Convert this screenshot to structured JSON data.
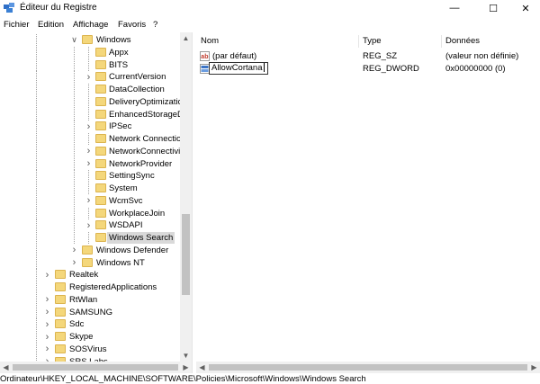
{
  "window": {
    "title": "Éditeur du Registre",
    "minimize": "—",
    "maximize": "☐",
    "close": "✕"
  },
  "menu": [
    "Fichier",
    "Edition",
    "Affichage",
    "Favoris",
    "?"
  ],
  "tree": {
    "items": [
      {
        "label": "Windows",
        "expander": "chevron-down",
        "level": 0
      },
      {
        "label": "Appx",
        "expander": "none",
        "level": 1
      },
      {
        "label": "BITS",
        "expander": "none",
        "level": 1
      },
      {
        "label": "CurrentVersion",
        "expander": "chevron-right",
        "level": 1
      },
      {
        "label": "DataCollection",
        "expander": "none",
        "level": 1
      },
      {
        "label": "DeliveryOptimizatic",
        "expander": "none",
        "level": 1
      },
      {
        "label": "EnhancedStorageDe",
        "expander": "none",
        "level": 1
      },
      {
        "label": "IPSec",
        "expander": "chevron-right",
        "level": 1
      },
      {
        "label": "Network Connectio",
        "expander": "none",
        "level": 1
      },
      {
        "label": "NetworkConnectivi",
        "expander": "chevron-right",
        "level": 1
      },
      {
        "label": "NetworkProvider",
        "expander": "chevron-right",
        "level": 1
      },
      {
        "label": "SettingSync",
        "expander": "none",
        "level": 1
      },
      {
        "label": "System",
        "expander": "none",
        "level": 1
      },
      {
        "label": "WcmSvc",
        "expander": "chevron-right",
        "level": 1
      },
      {
        "label": "WorkplaceJoin",
        "expander": "none",
        "level": 1
      },
      {
        "label": "WSDAPI",
        "expander": "chevron-right",
        "level": 1
      },
      {
        "label": "Windows Search",
        "expander": "none",
        "level": 1,
        "selected": true
      },
      {
        "label": "Windows Defender",
        "expander": "chevron-right",
        "level": 0
      },
      {
        "label": "Windows NT",
        "expander": "chevron-right",
        "level": 0
      },
      {
        "label": "Realtek",
        "expander": "chevron-right",
        "level": -1
      },
      {
        "label": "RegisteredApplications",
        "expander": "none",
        "level": -1
      },
      {
        "label": "RtWlan",
        "expander": "chevron-right",
        "level": -1
      },
      {
        "label": "SAMSUNG",
        "expander": "chevron-right",
        "level": -1
      },
      {
        "label": "Sdc",
        "expander": "chevron-right",
        "level": -1
      },
      {
        "label": "Skype",
        "expander": "chevron-right",
        "level": -1
      },
      {
        "label": "SOSVirus",
        "expander": "chevron-right",
        "level": -1
      },
      {
        "label": "SRS Labs",
        "expander": "chevron-right",
        "level": -1
      }
    ]
  },
  "list": {
    "columns": {
      "name": "Nom",
      "type": "Type",
      "data": "Données"
    },
    "rows": [
      {
        "name": "(par défaut)",
        "type": "REG_SZ",
        "data": "(valeur non définie)",
        "icon": "string-value-icon"
      },
      {
        "name": "AllowCortana",
        "type": "REG_DWORD",
        "data": "0x00000000 (0)",
        "icon": "dword-value-icon",
        "editing": true
      }
    ]
  },
  "status": {
    "path": "Ordinateur\\HKEY_LOCAL_MACHINE\\SOFTWARE\\Policies\\Microsoft\\Windows\\Windows Search"
  },
  "colors": {
    "folder": "#f4d77b",
    "selection": "#d9d9d9",
    "scrollbar": "#f0f0f0",
    "thumb": "#c2c2c2"
  }
}
